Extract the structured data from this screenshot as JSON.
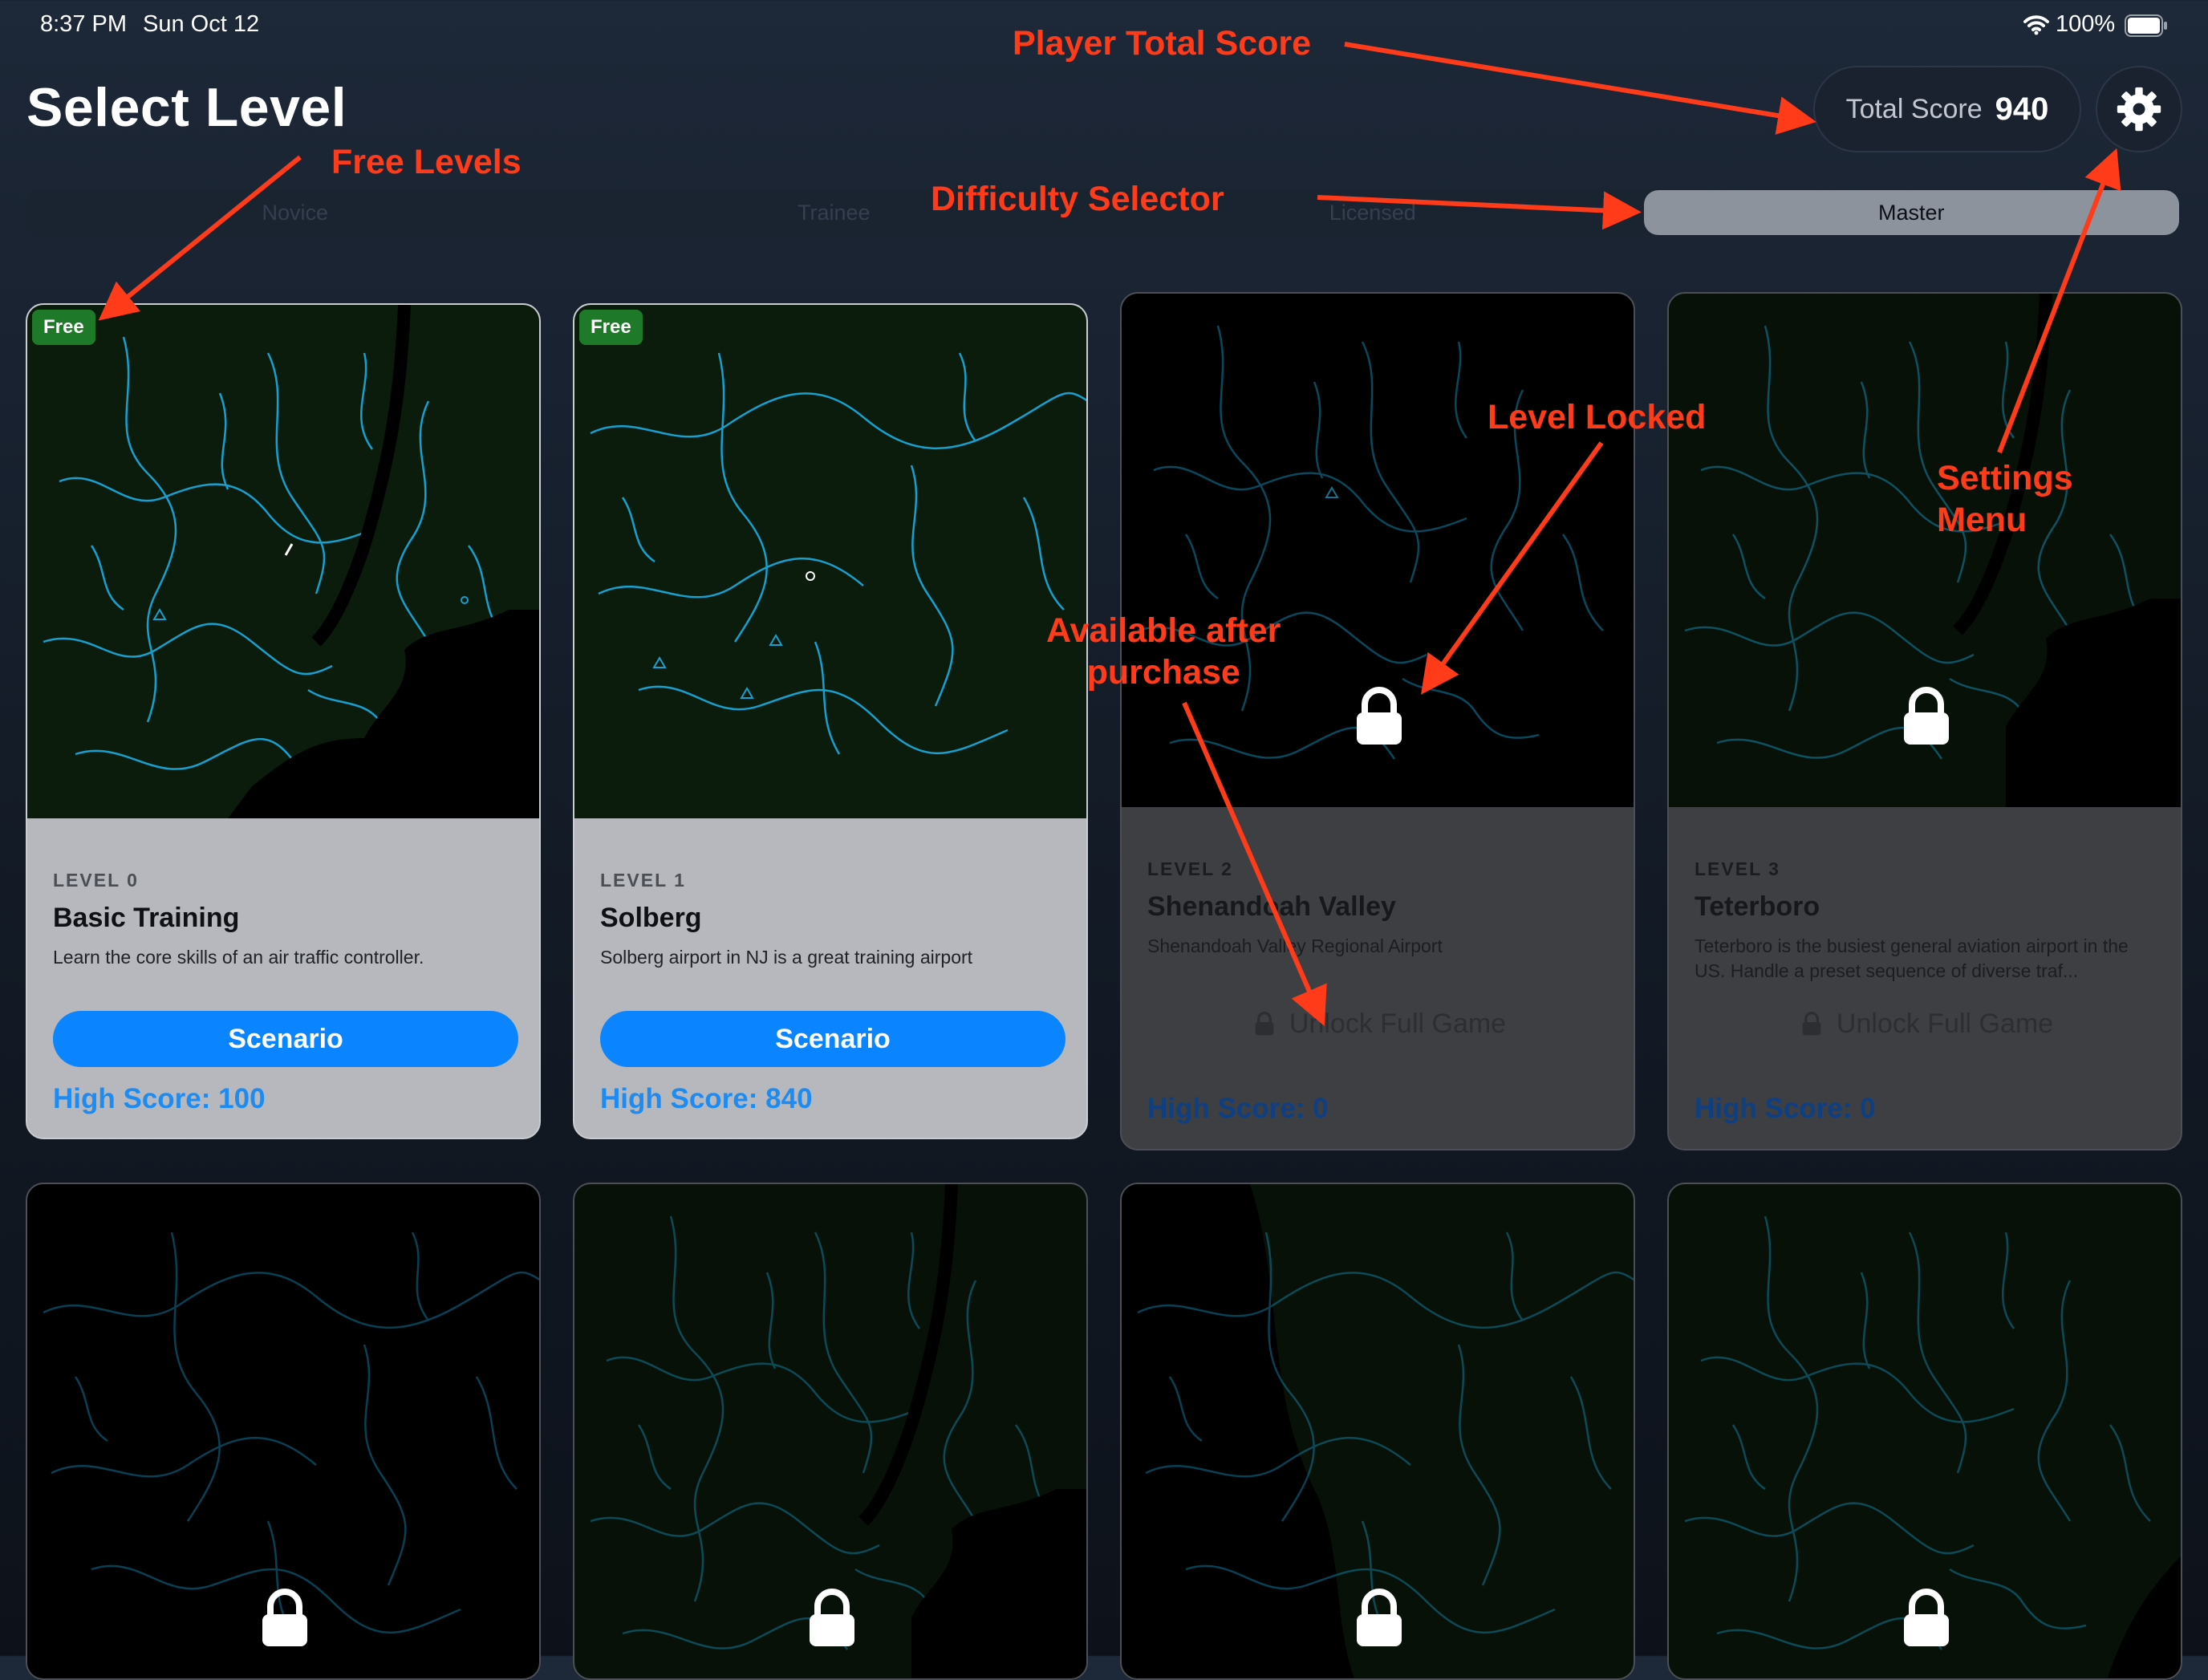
{
  "status_bar": {
    "time": "8:37 PM",
    "date": "Sun Oct 12",
    "battery": "100%"
  },
  "header": {
    "title": "Select Level",
    "total_score_label": "Total Score",
    "total_score_value": "940"
  },
  "difficulty": {
    "options": [
      "Novice",
      "Trainee",
      "Licensed",
      "Master"
    ],
    "selected": "Master"
  },
  "levels": [
    {
      "level": "LEVEL 0",
      "name": "Basic Training",
      "description": "Learn the core skills of an air traffic controller.",
      "badge": "Free",
      "button": "Scenario",
      "high_score": "High Score: 100",
      "locked": false
    },
    {
      "level": "LEVEL 1",
      "name": "Solberg",
      "description": "Solberg airport in NJ is a great training airport",
      "badge": "Free",
      "button": "Scenario",
      "high_score": "High Score: 840",
      "locked": false
    },
    {
      "level": "LEVEL 2",
      "name": "Shenandoah Valley",
      "description": "Shenandoah Valley Regional Airport",
      "button": "Unlock Full Game",
      "high_score": "High Score: 0",
      "locked": true
    },
    {
      "level": "LEVEL 3",
      "name": "Teterboro",
      "description": "Teterboro is the busiest general aviation airport in the US. Handle a preset sequence of diverse traf...",
      "button": "Unlock Full Game",
      "high_score": "High Score: 0",
      "locked": true
    }
  ],
  "annotations": {
    "player_total_score": "Player Total Score",
    "free_levels": "Free Levels",
    "difficulty_selector": "Difficulty Selector",
    "level_locked": "Level Locked",
    "settings_menu_1": "Settings",
    "settings_menu_2": "Menu",
    "available_1": "Available after",
    "available_2": "purchase"
  },
  "icons": [
    "wifi-icon",
    "battery-icon",
    "gear-icon",
    "lock-icon"
  ],
  "colors": {
    "accent": "#0a84ff",
    "free_badge": "#1e7a28",
    "annotation": "#ff3b1a",
    "map_land": "#0b1c0c",
    "map_water": "#1aa6d6"
  }
}
